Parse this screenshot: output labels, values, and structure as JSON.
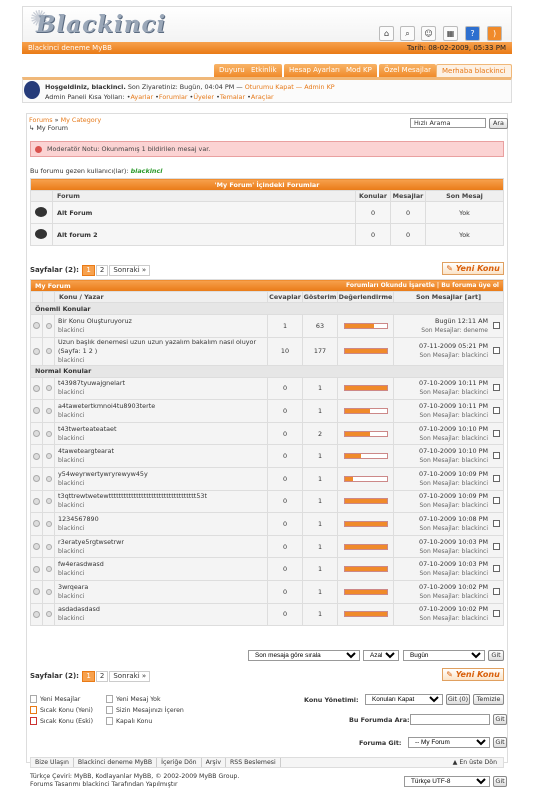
{
  "header": {
    "logo": "Blackinci",
    "site": "Blackinci deneme MyBB",
    "date": "Tarih: 08-02-2009, 05:33 PM"
  },
  "top_icons": [
    "home-icon",
    "search-icon",
    "members-icon",
    "calendar-icon",
    "help-icon",
    "rss-icon"
  ],
  "nav": [
    "Duyuru",
    "Etkinlik",
    "Hesap Ayarları",
    "Mod KP",
    "Özel Mesajlar",
    "Merhaba blackinci"
  ],
  "welcome": {
    "line1_a": "Hoşgeldiniz, blackinci.",
    "line1_b": " Son Ziyaretiniz: Bugün, 04:04 PM — ",
    "logout": "Oturumu Kapat",
    "admin": " — Admin KP",
    "line2": "Admin Paneli Kısa Yolları: ",
    "links": [
      "Ayarlar",
      "Forumlar",
      "Üyeler",
      "Temalar",
      "Araçlar"
    ]
  },
  "breadcrumb": {
    "forums": "Forums",
    "cat": "My Category",
    "cur": "My Forum"
  },
  "search": {
    "placeholder": "Hızlı Arama",
    "button": "Ara"
  },
  "alert": "Moderatör Notu: Okunmamış 1 bildirilen mesaj var.",
  "visitors": {
    "label": "Bu forumu gezen kullanıcı(lar): ",
    "user": "blackinci"
  },
  "subforums": {
    "title": "'My Forum' İçindeki Forumlar",
    "cols": [
      "Forum",
      "Konular",
      "Mesajlar",
      "Son Mesaj"
    ],
    "rows": [
      {
        "name": "Alt Forum",
        "topics": "0",
        "posts": "0",
        "last": "Yok"
      },
      {
        "name": "Alt forum 2",
        "topics": "0",
        "posts": "0",
        "last": "Yok"
      }
    ]
  },
  "pager": {
    "label": "Sayfalar (2):",
    "pages": [
      "1",
      "2"
    ],
    "next": "Sonraki »"
  },
  "new_topic": "Yeni Konu",
  "threads": {
    "title": "My Forum",
    "links": "Forumları Okundu İşaretle | Bu foruma üye ol",
    "cols": [
      "Konu / Yazar",
      "Cevaplar",
      "Gösterim",
      "Değerlendirme",
      "Son Mesajlar [art]"
    ],
    "sticky_label": "Önemli Konular",
    "normal_label": "Normal Konular",
    "sticky": [
      {
        "title": "Bir Konu Oluşturuyoruz",
        "author": "blackinci",
        "replies": "1",
        "views": "63",
        "rating": 0.7,
        "date": "Bugün 12:11 AM",
        "by": "Son Mesajlar: deneme"
      },
      {
        "title": "Uzun başlık denemesi uzun uzun yazalım bakalım nasıl oluyor",
        "pages": "(Sayfa: 1 2 )",
        "author": "blackinci",
        "replies": "10",
        "views": "177",
        "rating": 1.0,
        "date": "07-11-2009 05:21 PM",
        "by": "Son Mesajlar: blackinci"
      }
    ],
    "normal": [
      {
        "title": "t43987tyuwajgnelart",
        "author": "blackinci",
        "replies": "0",
        "views": "1",
        "rating": 1.0,
        "date": "07-10-2009 10:11 PM",
        "by": "Son Mesajlar: blackinci"
      },
      {
        "title": "a4tawetertkmnoi4tu8903terte",
        "author": "blackinci",
        "replies": "0",
        "views": "1",
        "rating": 0.6,
        "date": "07-10-2009 10:11 PM",
        "by": "Son Mesajlar: blackinci"
      },
      {
        "title": "t43twerteateataet",
        "author": "blackinci",
        "replies": "0",
        "views": "2",
        "rating": 0.6,
        "date": "07-10-2009 10:10 PM",
        "by": "Son Mesajlar: blackinci"
      },
      {
        "title": "4taweteargtearat",
        "author": "blackinci",
        "replies": "0",
        "views": "1",
        "rating": 0.4,
        "date": "07-10-2009 10:10 PM",
        "by": "Son Mesajlar: blackinci"
      },
      {
        "title": "y54weyrwertywryrewyw45y",
        "author": "blackinci",
        "replies": "0",
        "views": "1",
        "rating": 0.2,
        "date": "07-10-2009 10:09 PM",
        "by": "Son Mesajlar: blackinci"
      },
      {
        "title": "t3qttrewtwetewttttttttttttttttttttttttttttttttttt53t",
        "author": "blackinci",
        "replies": "0",
        "views": "1",
        "rating": 1.0,
        "date": "07-10-2009 10:09 PM",
        "by": "Son Mesajlar: blackinci"
      },
      {
        "title": "1234567890",
        "author": "blackinci",
        "replies": "0",
        "views": "1",
        "rating": 1.0,
        "date": "07-10-2009 10:08 PM",
        "by": "Son Mesajlar: blackinci"
      },
      {
        "title": "r3eratye5rgtwsetrwr",
        "author": "blackinci",
        "replies": "0",
        "views": "1",
        "rating": 1.0,
        "date": "07-10-2009 10:03 PM",
        "by": "Son Mesajlar: blackinci"
      },
      {
        "title": "fw4erasdwasd",
        "author": "blackinci",
        "replies": "0",
        "views": "1",
        "rating": 1.0,
        "date": "07-10-2009 10:03 PM",
        "by": "Son Mesajlar: blackinci"
      },
      {
        "title": "3wrqeara",
        "author": "blackinci",
        "replies": "0",
        "views": "1",
        "rating": 1.0,
        "date": "07-10-2009 10:02 PM",
        "by": "Son Mesajlar: blackinci"
      },
      {
        "title": "asdadasdasd",
        "author": "blackinci",
        "replies": "0",
        "views": "1",
        "rating": 1.0,
        "date": "07-10-2009 10:02 PM",
        "by": "Son Mesajlar: blackinci"
      }
    ]
  },
  "sort": {
    "by": "Son mesaja göre sırala",
    "order": "Azalan",
    "range": "Bugün",
    "go": "Git"
  },
  "legend": [
    "Yeni Mesajlar",
    "Sıcak Konu (Yeni)",
    "Sıcak Konu (Eski)",
    "Yeni Mesaj Yok",
    "Sizin Mesajınızı İçeren",
    "Kapalı Konu"
  ],
  "moderation": {
    "label": "Konu Yönetimi:",
    "value": "Konuları Kapat",
    "go": "Git (0)",
    "clear": "Temizle"
  },
  "forum_search": {
    "label": "Bu Forumda Ara:",
    "button": "Git"
  },
  "forum_jump": {
    "label": "Foruma Git:",
    "value": "-- My Forum",
    "button": "Git"
  },
  "footer": {
    "links": [
      "Bize Ulaşın",
      "Blackinci deneme MyBB",
      "İçeriğe Dön",
      "Arşiv",
      "RSS Beslemesi"
    ],
    "top": "En üste Dön",
    "copy1": "Türkçe Çeviri: MyBB, Kodlayanlar MyBB, © 2002-2009 MyBB Group.",
    "copy2": "Forums Tasarımı blackinci Tarafından Yapılmıştır",
    "lang": "Türkçe UTF-8",
    "go": "Git"
  }
}
